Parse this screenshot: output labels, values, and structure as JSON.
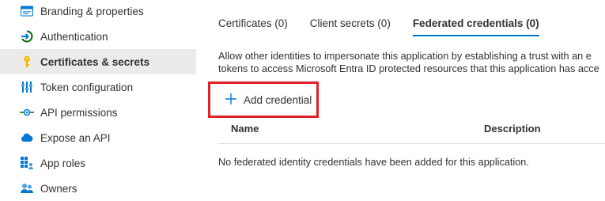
{
  "sidebar": {
    "items": [
      {
        "label": "Branding & properties",
        "icon": "branding-icon",
        "active": false
      },
      {
        "label": "Authentication",
        "icon": "authentication-icon",
        "active": false
      },
      {
        "label": "Certificates & secrets",
        "icon": "key-icon",
        "active": true
      },
      {
        "label": "Token configuration",
        "icon": "token-configuration-icon",
        "active": false
      },
      {
        "label": "API permissions",
        "icon": "api-permissions-icon",
        "active": false
      },
      {
        "label": "Expose an API",
        "icon": "cloud-icon",
        "active": false
      },
      {
        "label": "App roles",
        "icon": "app-roles-icon",
        "active": false
      },
      {
        "label": "Owners",
        "icon": "owners-icon",
        "active": false
      }
    ]
  },
  "tabs": [
    {
      "label": "Certificates (0)",
      "active": false
    },
    {
      "label": "Client secrets (0)",
      "active": false
    },
    {
      "label": "Federated credentials (0)",
      "active": true
    }
  ],
  "description": {
    "line1": "Allow other identities to impersonate this application by establishing a trust with an e",
    "line2": "tokens to access Microsoft Entra ID protected resources that this application has acce"
  },
  "add_button": {
    "label": "Add credential",
    "icon": "plus-icon"
  },
  "table": {
    "columns": [
      "Name",
      "Description"
    ],
    "empty_message": "No federated identity credentials have been added for this application."
  },
  "colors": {
    "accent": "#0078d4",
    "highlight_border": "#e21f26",
    "active_bg": "#edebe9"
  }
}
